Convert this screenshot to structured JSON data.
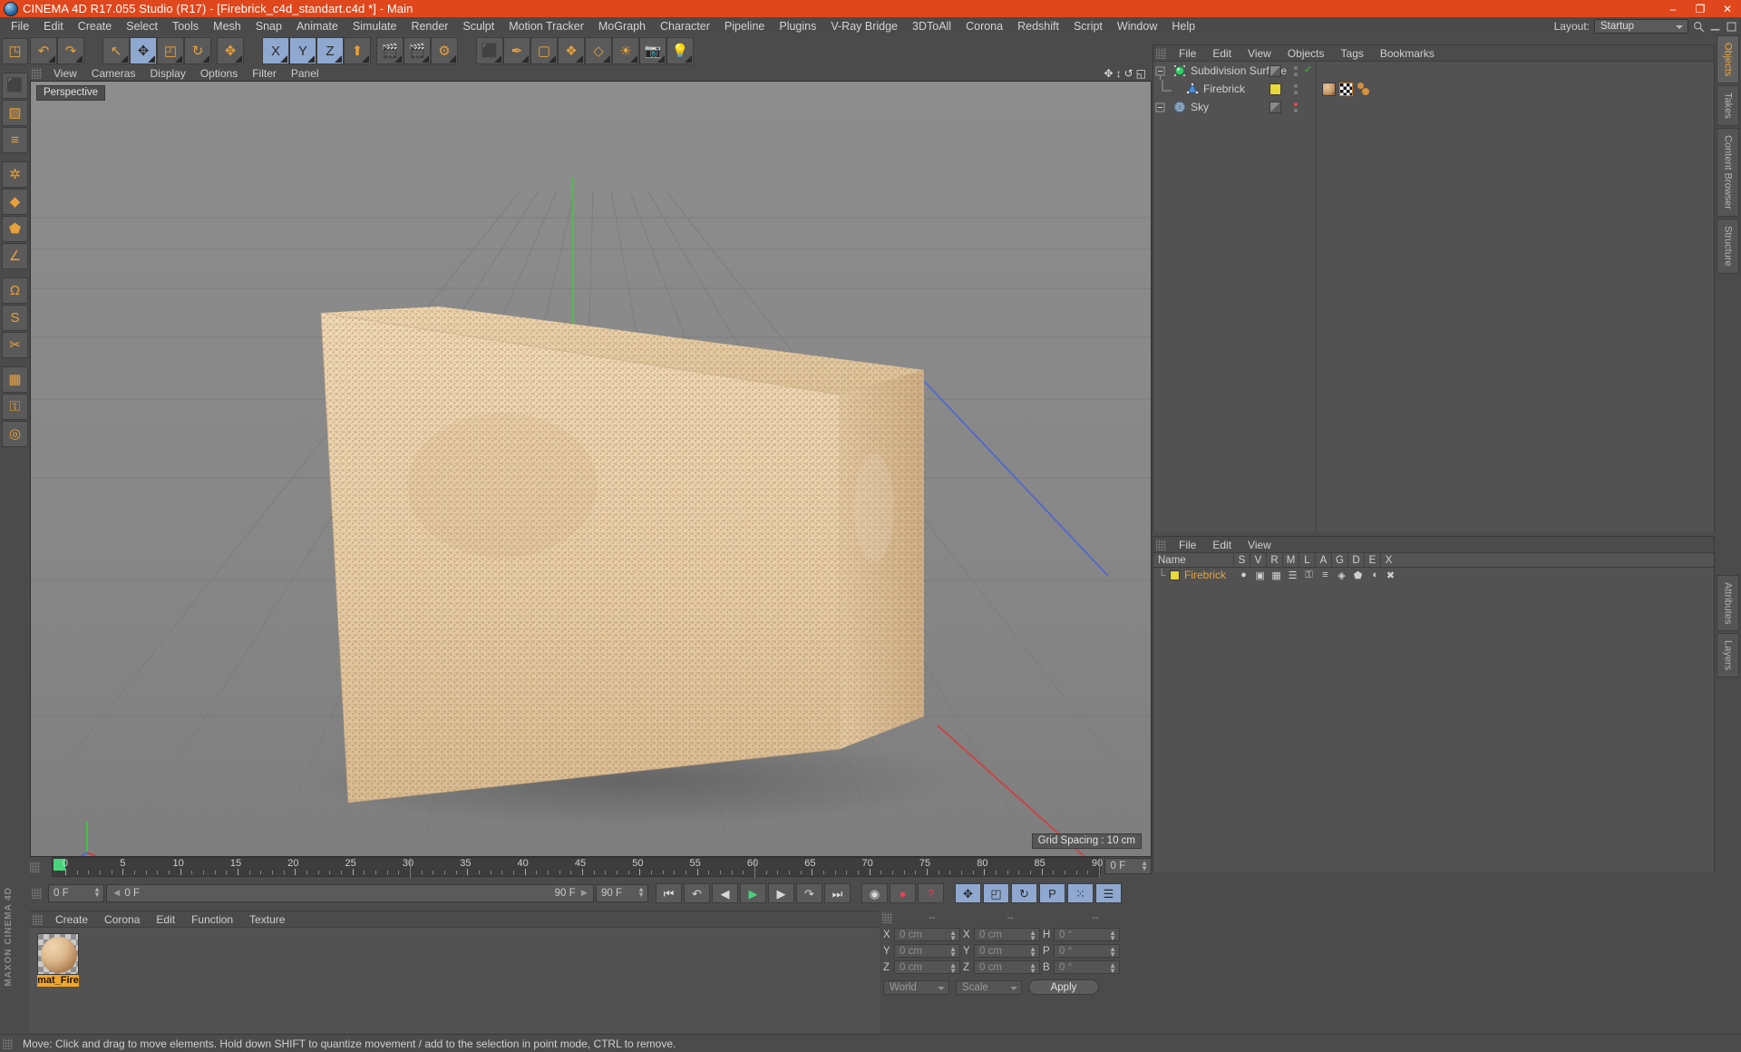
{
  "window": {
    "title": "CINEMA 4D R17.055 Studio (R17) - [Firebrick_c4d_standart.c4d *] - Main",
    "app_icon": "c4d-logo-icon",
    "minimize": "–",
    "maximize": "❐",
    "close": "✕"
  },
  "menubar": {
    "items": [
      "File",
      "Edit",
      "Create",
      "Select",
      "Tools",
      "Mesh",
      "Snap",
      "Animate",
      "Simulate",
      "Render",
      "Sculpt",
      "Motion Tracker",
      "MoGraph",
      "Character",
      "Pipeline",
      "Plugins",
      "V-Ray Bridge",
      "3DToAll",
      "Corona",
      "Redshift",
      "Script",
      "Window",
      "Help"
    ],
    "layout_label": "Layout:",
    "layout_value": "Startup",
    "search_icon": "search-icon",
    "window_min_icon": "window-minimize-icon",
    "window_max_icon": "window-maximize-icon"
  },
  "left_toolbar": {
    "buttons": [
      {
        "name": "live-selection-tool",
        "glyph": "◳"
      },
      {
        "name": "box-object-tool",
        "glyph": "⬛"
      },
      {
        "name": "checker-selection-tool",
        "glyph": "▨"
      },
      {
        "name": "layers-tool",
        "glyph": "≡"
      },
      {
        "name": "axis-mode-tool",
        "glyph": "✲"
      },
      {
        "name": "point-mode-tool",
        "glyph": "◆"
      },
      {
        "name": "polygon-mode-tool",
        "glyph": "⬟"
      },
      {
        "name": "edge-mode-tool",
        "glyph": "∠"
      },
      {
        "name": "magnet-tool",
        "glyph": "Ω"
      },
      {
        "name": "smooth-shift-tool",
        "glyph": "S"
      },
      {
        "name": "knife-tool",
        "glyph": "✂"
      },
      {
        "name": "texture-axis-tool",
        "glyph": "▦"
      },
      {
        "name": "lock-axis-tool",
        "glyph": "⚿"
      },
      {
        "name": "workplane-tool",
        "glyph": "◎"
      }
    ],
    "brand_line1": "MAXON",
    "brand_line2": "CINEMA 4D"
  },
  "toolbar": {
    "groups": [
      {
        "cells": [
          {
            "name": "undo-button",
            "glyph": "↶",
            "active": false
          },
          {
            "name": "redo-button",
            "glyph": "↷",
            "active": false
          }
        ]
      },
      {
        "cells": [
          {
            "name": "select-tool-button",
            "glyph": "↖",
            "active": false
          },
          {
            "name": "move-tool-button",
            "glyph": "✥",
            "active": true
          },
          {
            "name": "scale-tool-button",
            "glyph": "◰",
            "active": false
          },
          {
            "name": "rotate-tool-button",
            "glyph": "↻",
            "active": false
          }
        ]
      },
      {
        "cells": [
          {
            "name": "move-axis-button",
            "glyph": "✥",
            "active": false
          }
        ]
      },
      {
        "cells": [
          {
            "name": "x-axis-lock-button",
            "glyph": "X",
            "active": true
          },
          {
            "name": "y-axis-lock-button",
            "glyph": "Y",
            "active": true
          },
          {
            "name": "z-axis-lock-button",
            "glyph": "Z",
            "active": true
          },
          {
            "name": "world-object-coord-button",
            "glyph": "⬆",
            "active": false
          }
        ]
      },
      {
        "cells": [
          {
            "name": "render-view-button",
            "glyph": "🎬",
            "active": false
          },
          {
            "name": "render-region-button",
            "glyph": "🎬",
            "active": false
          },
          {
            "name": "render-settings-button",
            "glyph": "⚙",
            "active": false
          }
        ]
      },
      {
        "cells": [
          {
            "name": "add-cube-button",
            "glyph": "⬛",
            "active": false
          },
          {
            "name": "spline-pen-button",
            "glyph": "✒",
            "active": false
          },
          {
            "name": "nurbs-object-button",
            "glyph": "▢",
            "active": false
          },
          {
            "name": "array-object-button",
            "glyph": "❖",
            "active": false
          },
          {
            "name": "deformer-button",
            "glyph": "◇",
            "active": false
          },
          {
            "name": "environment-button",
            "glyph": "☀",
            "active": false
          },
          {
            "name": "camera-button",
            "glyph": "📷",
            "active": false
          },
          {
            "name": "light-button",
            "glyph": "💡",
            "active": false
          }
        ]
      }
    ]
  },
  "viewport": {
    "menu": [
      "View",
      "Cameras",
      "Display",
      "Options",
      "Filter",
      "Panel"
    ],
    "perspective_label": "Perspective",
    "grid_spacing": "Grid Spacing : 10 cm",
    "corner_icons": [
      "pan-view-icon",
      "zoom-view-icon",
      "rotate-view-icon",
      "layout-view-icon"
    ],
    "object_description": "firebrick-3d-model"
  },
  "object_manager": {
    "menu": [
      "File",
      "Edit",
      "View",
      "Objects",
      "Tags",
      "Bookmarks"
    ],
    "rows": [
      {
        "name": "Subdivision Surface",
        "icon": "subdivision-surface-icon",
        "depth": 0,
        "visibility_chip": "grey",
        "enabled_check": "✓",
        "tags": []
      },
      {
        "name": "Firebrick",
        "icon": "polygon-object-icon",
        "depth": 1,
        "visibility_chip": "yellow",
        "enabled_check": "",
        "tags": [
          "material-tag",
          "texture-checker-tag",
          "phong-tag"
        ]
      },
      {
        "name": "Sky",
        "icon": "sky-object-icon",
        "depth": 0,
        "visibility_chip": "grey",
        "enabled_check": "",
        "dot_color": "red",
        "tags": []
      }
    ]
  },
  "layer_manager": {
    "menu": [
      "File",
      "Edit",
      "View"
    ],
    "columns": [
      "Name",
      "S",
      "V",
      "R",
      "M",
      "L",
      "A",
      "G",
      "D",
      "E",
      "X"
    ],
    "rows": [
      {
        "name": "Firebrick",
        "swatch_color": "#e9d83a",
        "icons": [
          "solo-icon",
          "view-icon",
          "render-icon",
          "manager-icon",
          "lock-icon",
          "animation-icon",
          "generators-icon",
          "deformers-icon",
          "expressions-icon",
          "xref-icon"
        ]
      }
    ]
  },
  "timeline": {
    "ticks": [
      0,
      5,
      10,
      15,
      20,
      25,
      30,
      35,
      40,
      45,
      50,
      55,
      60,
      65,
      70,
      75,
      80,
      85,
      90
    ],
    "current_frame_marker": 0,
    "end_frame_label": "0 F"
  },
  "playbar": {
    "current_frame": "0 F",
    "range_start": "0 F",
    "range_end": "90 F",
    "preview_end": "90 F",
    "buttons": [
      {
        "name": "go-to-start-button",
        "glyph": "⏮",
        "active": false
      },
      {
        "name": "previous-keyframe-button",
        "glyph": "↶",
        "active": false
      },
      {
        "name": "previous-frame-button",
        "glyph": "◀",
        "active": false
      },
      {
        "name": "play-button",
        "glyph": "▶",
        "active": false
      },
      {
        "name": "next-frame-button",
        "glyph": "▶",
        "active": false
      },
      {
        "name": "next-keyframe-button",
        "glyph": "↷",
        "active": false
      },
      {
        "name": "go-to-end-button",
        "glyph": "⏭",
        "active": false
      },
      {
        "name": "record-active-objects-button",
        "glyph": "◉",
        "active": false
      },
      {
        "name": "autokeying-button",
        "glyph": "●",
        "active": false
      },
      {
        "name": "keyframe-selection-button",
        "glyph": "?",
        "active": false
      },
      {
        "name": "record-position-button",
        "glyph": "✥",
        "active": true
      },
      {
        "name": "record-scale-button",
        "glyph": "◰",
        "active": true
      },
      {
        "name": "record-rotation-button",
        "glyph": "↻",
        "active": true
      },
      {
        "name": "record-parameter-button",
        "glyph": "P",
        "active": true
      },
      {
        "name": "point-level-animation-button",
        "glyph": "⁙",
        "active": true
      },
      {
        "name": "keyframe-list-button",
        "glyph": "☰",
        "active": true
      }
    ]
  },
  "material_manager": {
    "menu": [
      "Create",
      "Corona",
      "Edit",
      "Function",
      "Texture"
    ],
    "materials": [
      {
        "name": "mat_Fire",
        "preview": "brick-material-sphere"
      }
    ]
  },
  "coordinates": {
    "header_dashes": [
      "--",
      "--",
      "--"
    ],
    "rows": [
      {
        "label1": "X",
        "value1": "0 cm",
        "label2": "X",
        "value2": "0 cm",
        "label3": "H",
        "value3": "0 °"
      },
      {
        "label1": "Y",
        "value1": "0 cm",
        "label2": "Y",
        "value2": "0 cm",
        "label3": "P",
        "value3": "0 °"
      },
      {
        "label1": "Z",
        "value1": "0 cm",
        "label2": "Z",
        "value2": "0 cm",
        "label3": "B",
        "value3": "0 °"
      }
    ],
    "system": "World",
    "mode": "Scale",
    "apply": "Apply"
  },
  "statusbar": {
    "message": "Move: Click and drag to move elements. Hold down SHIFT to quantize movement / add to the selection in point mode, CTRL to remove."
  },
  "right_tabs": {
    "upper": [
      {
        "label": "Objects",
        "active": true
      },
      {
        "label": "Takes",
        "active": false
      },
      {
        "label": "Content Browser",
        "active": false
      },
      {
        "label": "Structure",
        "active": false
      }
    ],
    "lower": [
      {
        "label": "Attributes",
        "active": false
      },
      {
        "label": "Layers",
        "active": false
      }
    ]
  }
}
